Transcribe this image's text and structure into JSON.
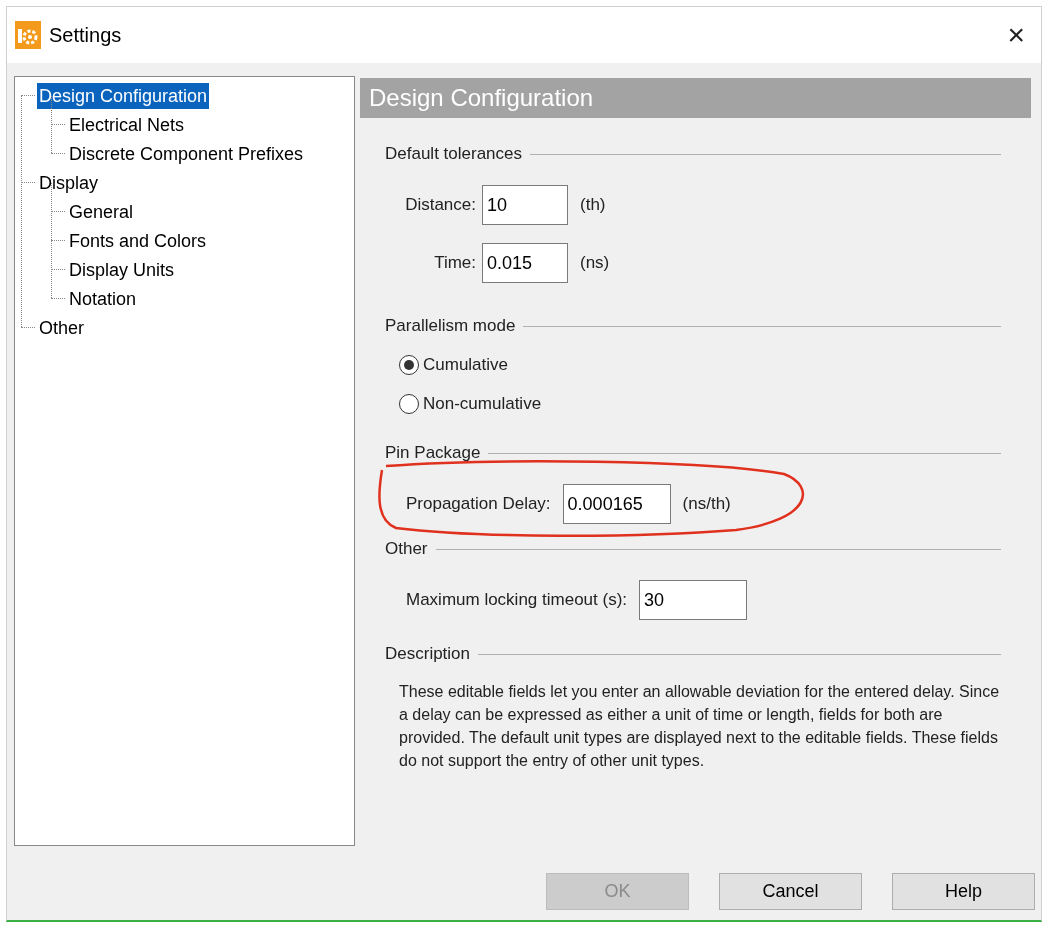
{
  "window": {
    "title": "Settings",
    "close": "×"
  },
  "tree": [
    {
      "label": "Design Configuration",
      "selected": true,
      "children": [
        {
          "label": "Electrical Nets",
          "selected": false
        },
        {
          "label": "Discrete Component Prefixes",
          "selected": false
        }
      ]
    },
    {
      "label": "Display",
      "selected": false,
      "children": [
        {
          "label": "General",
          "selected": false
        },
        {
          "label": "Fonts and Colors",
          "selected": false
        },
        {
          "label": "Display Units",
          "selected": false
        },
        {
          "label": "Notation",
          "selected": false
        }
      ]
    },
    {
      "label": "Other",
      "selected": false
    }
  ],
  "panel": {
    "header": "Design Configuration",
    "sections": [
      {
        "kind": "aligned-fields",
        "legend": "Default tolerances",
        "fields": [
          {
            "label": "Distance:",
            "value": "10",
            "unit": "(th)"
          },
          {
            "label": "Time:",
            "value": "0.015",
            "unit": "(ns)"
          }
        ]
      },
      {
        "kind": "radios",
        "legend": "Parallelism mode",
        "options": [
          {
            "label": "Cumulative",
            "selected": true
          },
          {
            "label": "Non-cumulative",
            "selected": false
          }
        ]
      },
      {
        "kind": "fields",
        "legend": "Pin Package",
        "fields": [
          {
            "label": "Propagation Delay:",
            "value": "0.000165",
            "unit": "(ns/th)"
          }
        ]
      },
      {
        "kind": "fields",
        "legend": "Other",
        "fields": [
          {
            "label": "Maximum locking timeout (s):",
            "value": "30"
          }
        ]
      },
      {
        "kind": "text",
        "legend": "Description",
        "text": "These editable fields let you enter an allowable deviation for the entered delay. Since a delay can be expressed as either a unit of time or length, fields for both are provided. The default unit types are displayed next to the editable fields. These fields do not support the entry of other unit types."
      }
    ]
  },
  "buttons": [
    {
      "label": "OK",
      "disabled": true
    },
    {
      "label": "Cancel",
      "disabled": false
    },
    {
      "label": "Help",
      "disabled": false
    }
  ]
}
